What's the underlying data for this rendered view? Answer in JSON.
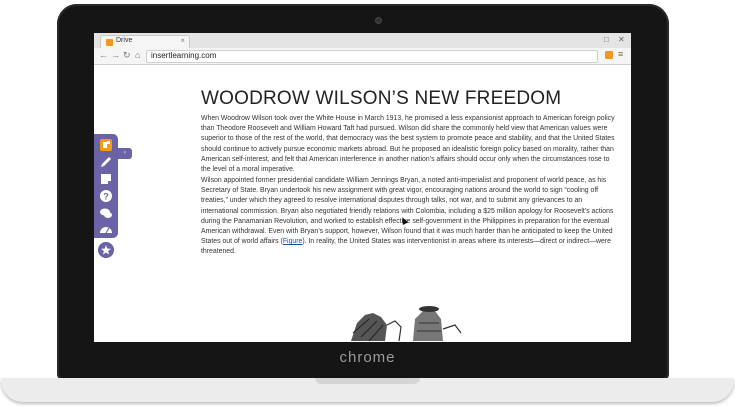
{
  "device": {
    "brand": "chrome"
  },
  "browser": {
    "tab_title": "Drive",
    "url": "insertlearning.com",
    "tab_close": "×",
    "window_restore": "□",
    "window_close": "✕"
  },
  "article": {
    "title": "WOODROW WILSON’S NEW FREEDOM",
    "paragraph1": "When Woodrow Wilson took over the White House in March 1913, he promised a less expansionist approach to American foreign policy than Theodore Roosevelt and William Howard Taft had pursued. Wilson did share the commonly held view that American values were superior to those of the rest of the world, that democracy was the best system to promote peace and stability, and that the United States should continue to actively pursue economic markets abroad. But he proposed an idealistic foreign policy based on morality, rather than American self-interest, and felt that American interference in another nation’s affairs should occur only when the circumstances rose to the level of a moral imperative.",
    "paragraph2_before_link": "Wilson appointed former presidential candidate William Jennings Bryan, a noted anti-imperialist and proponent of world peace, as his Secretary of State. Bryan undertook his new assignment with great vigor, encouraging nations around the world to sign “cooling off treaties,” under which they agreed to resolve international disputes through talks, not war, and to submit any grievances to an international commission. Bryan also negotiated friendly relations with Colombia, including a $25 million apology for Roosevelt’s actions during the Panamanian Revolution, and worked to establish effective self-government in the Philippines in preparation for the eventual American withdrawal. Even with Bryan’s support, however, Wilson found that it was much harder than he anticipated to keep the United States out of world affairs (",
    "figure_link": "Figure",
    "paragraph2_after_link": "). In reality, the United States was interventionist in areas where its interests—direct or indirect—were threatened."
  },
  "sidebar": {
    "collapse_label": "‹",
    "items": [
      {
        "icon": "insertlearning-logo-icon"
      },
      {
        "icon": "pencil-icon"
      },
      {
        "icon": "sticky-note-icon"
      },
      {
        "icon": "question-icon"
      },
      {
        "icon": "discussion-icon"
      },
      {
        "icon": "dashboard-icon"
      }
    ],
    "star_icon": "star-icon"
  },
  "colors": {
    "sidebar": "#6a64a6",
    "accent": "#f39a1e",
    "link": "#1a4fa3"
  }
}
